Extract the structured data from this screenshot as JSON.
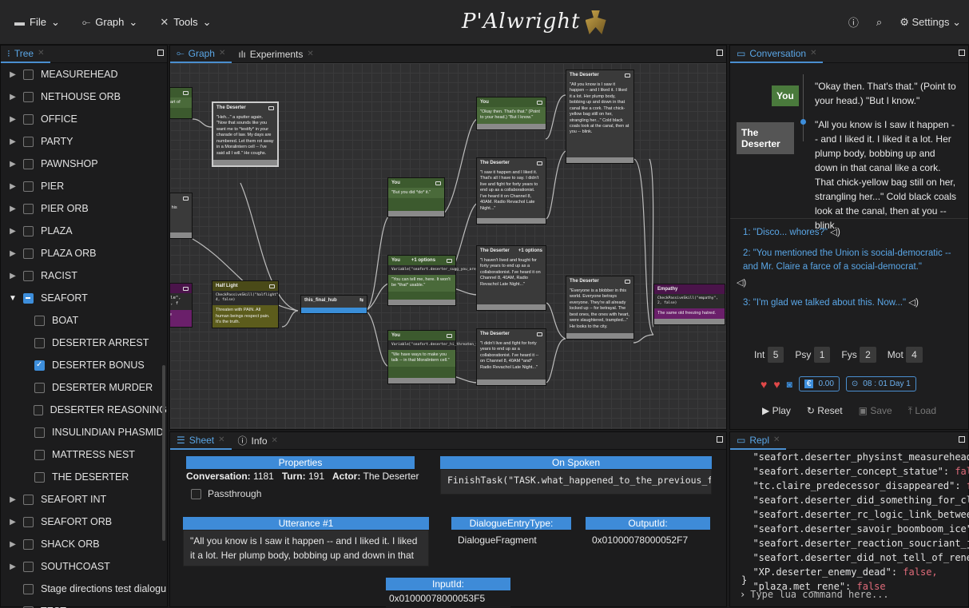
{
  "menu": {
    "file": "File",
    "graph": "Graph",
    "tools": "Tools",
    "settings": "Settings"
  },
  "logo": "P'Alwright",
  "tree": {
    "tab": "Tree",
    "items": [
      {
        "label": "MEASUREHEAD",
        "state": "none",
        "expand": "collapsed",
        "indent": 0
      },
      {
        "label": "NETHOUSE ORB",
        "state": "none",
        "expand": "collapsed",
        "indent": 0
      },
      {
        "label": "OFFICE",
        "state": "none",
        "expand": "collapsed",
        "indent": 0
      },
      {
        "label": "PARTY",
        "state": "none",
        "expand": "collapsed",
        "indent": 0
      },
      {
        "label": "PAWNSHOP",
        "state": "none",
        "expand": "collapsed",
        "indent": 0
      },
      {
        "label": "PIER",
        "state": "none",
        "expand": "collapsed",
        "indent": 0
      },
      {
        "label": "PIER ORB",
        "state": "none",
        "expand": "collapsed",
        "indent": 0
      },
      {
        "label": "PLAZA",
        "state": "none",
        "expand": "collapsed",
        "indent": 0
      },
      {
        "label": "PLAZA ORB",
        "state": "none",
        "expand": "collapsed",
        "indent": 0
      },
      {
        "label": "RACIST",
        "state": "none",
        "expand": "collapsed",
        "indent": 0
      },
      {
        "label": "SEAFORT",
        "state": "partial",
        "expand": "expanded",
        "indent": 0
      },
      {
        "label": "BOAT",
        "state": "none",
        "expand": "leaf",
        "indent": 1
      },
      {
        "label": "DESERTER ARREST",
        "state": "none",
        "expand": "leaf",
        "indent": 1
      },
      {
        "label": "DESERTER BONUS",
        "state": "checked",
        "expand": "leaf",
        "indent": 1
      },
      {
        "label": "DESERTER MURDER",
        "state": "none",
        "expand": "leaf",
        "indent": 1
      },
      {
        "label": "DESERTER REASONING",
        "state": "none",
        "expand": "leaf",
        "indent": 1
      },
      {
        "label": "INSULINDIAN PHASMID",
        "state": "none",
        "expand": "leaf",
        "indent": 1
      },
      {
        "label": "MATTRESS NEST",
        "state": "none",
        "expand": "leaf",
        "indent": 1
      },
      {
        "label": "THE DESERTER",
        "state": "none",
        "expand": "leaf",
        "indent": 1
      },
      {
        "label": "SEAFORT INT",
        "state": "none",
        "expand": "collapsed",
        "indent": 0
      },
      {
        "label": "SEAFORT ORB",
        "state": "none",
        "expand": "collapsed",
        "indent": 0
      },
      {
        "label": "SHACK ORB",
        "state": "none",
        "expand": "collapsed",
        "indent": 0
      },
      {
        "label": "SOUTHCOAST",
        "state": "none",
        "expand": "collapsed",
        "indent": 0
      },
      {
        "label": "Stage directions test dialogu",
        "state": "none",
        "expand": "leaf",
        "indent": 0
      },
      {
        "label": "TEST",
        "state": "none",
        "expand": "collapsed",
        "indent": 0
      }
    ]
  },
  "graph": {
    "tabs": [
      "Graph",
      "Experiments"
    ],
    "nodes": {
      "d1": {
        "title": "The Deserter",
        "body": "\"Heh...\" a sputter again. \"Now that sounds like you want me to *testify* in your charade of law. My days are numbered. Let them rot away in a Moralintern cell -- I've said all I will.\" He coughs."
      },
      "half": {
        "title": "Half Light",
        "code": "CheckPassiveSkill(\"halflight\", 4, false)",
        "body": "Threaten with PAIN. All human beings respect pain. It's the truth."
      },
      "hub": {
        "title": "this_final_hub"
      },
      "you1": {
        "title": "You",
        "body": "\"But you did *do* it.\""
      },
      "you2": {
        "title": "You",
        "opts": "+1 options",
        "code": "Variable[\"seafort.deserter_sugg_you_are_babbies\"]",
        "body": "\"You can tell me, here. It won't be *that* usable.\""
      },
      "you3": {
        "title": "You",
        "code": "Variable[\"seafort.deserter_hi_threaten_with_pain\"]",
        "body": "\"We have ways to make you talk -- in that Moralintern cell.\""
      },
      "you4": {
        "title": "You",
        "body": "\"Okay then. That's that.\" (Point to your head.) \"But I know.\""
      },
      "d2": {
        "title": "The Deserter",
        "body": "\"All you know is I saw it happen -- and I liked it. I liked it a lot. Her plump body, bobbing up and down in that canal like a cork. That chick-yellow bag still on her, strangling her...\" Cold black coals look at the canal, then at you -- blink."
      },
      "d3": {
        "title": "The Deserter",
        "body": "\"I saw it happen and I liked it. That's all I have to say. I didn't live and fight for forty years to end up as a collaborationist. I've heard it on Channel 8, 40AM. Radio Revachol Late Night...\""
      },
      "d4": {
        "title": "The Deserter",
        "opts": "+1 options",
        "body": "\"I haven't lived and fought for forty years to end up as a collaborationist. I've heard it on Channel 8, 40AM, Radio Revachol Late Night...\""
      },
      "d5": {
        "title": "The Deserter",
        "body": "\"I didn't live and fight for forty years to end up as a collaborationist. I've heard it -- on Channel 8, 40AM *and* Radio Revachol Late Night...\""
      },
      "d6": {
        "title": "The Deserter",
        "body": "\"Everyone is a blobber in this world. Everyone betrays everyone. They're all already locked up -- for betrayal. The best ones, the ones with heart, were slaughtered, trampled...\" He looks to the city."
      },
      "emp": {
        "title": "Empathy",
        "code": "CheckPassiveSkill(\"empathy\", 2, false)",
        "body": "The same old freezing hatred."
      },
      "frag1": {
        "title": "eart of"
      },
      "frag2": {
        "title": "p his"
      },
      "frag3": {
        "code": "ple\", 4, f",
        "body": "re"
      }
    }
  },
  "conversation": {
    "tab": "Conversation",
    "you_label": "You",
    "you_text": "\"Okay then. That's that.\" (Point to your head.) \"But I know.\"",
    "npc_label": "The Deserter",
    "npc_text": "\"All you know is I saw it happen -- and I liked it. I liked it a lot. Her plump body, bobbing up and down in that canal like a cork. That chick-yellow bag still on her, strangling her...\" Cold black coals look at the canal, then at you -- blink.",
    "choices": [
      "1: \"Disco... whores?\"",
      "2: \"You mentioned the Union is social-democratic -- and Mr. Claire a farce of a social-democrat.\"",
      "3: \"I'm glad we talked about this. Now...\""
    ],
    "stats": [
      {
        "k": "Int",
        "v": "5"
      },
      {
        "k": "Psy",
        "v": "1"
      },
      {
        "k": "Fys",
        "v": "2"
      },
      {
        "k": "Mot",
        "v": "4"
      }
    ],
    "money": "0.00",
    "time": "08 : 01 Day 1",
    "actions": [
      "Play",
      "Reset",
      "Save",
      "Load"
    ]
  },
  "sheet": {
    "tabs": [
      "Sheet",
      "Info"
    ],
    "properties_hdr": "Properties",
    "conv_label": "Conversation:",
    "conv_val": "1181",
    "turn_label": "Turn:",
    "turn_val": "191",
    "actor_label": "Actor:",
    "actor_val": "The Deserter",
    "passthrough": "Passthrough",
    "onspoken_hdr": "On Spoken",
    "onspoken_val": "FinishTask(\"TASK.what_happened_to_the_previous_fo",
    "utter_hdr": "Utterance #1",
    "utter_val": "\"All you know is I saw it happen -- and I liked it. I liked it a lot. Her plump body, bobbing up and down in that canal like a cork. That chick-yellow bag still on her",
    "det_hdr": "DialogueEntryType:",
    "det_val": "DialogueFragment",
    "out_hdr": "OutputId:",
    "out_val": "0x01000078000052F7",
    "in_hdr": "InputId:",
    "in_val": "0x01000078000053F5"
  },
  "repl": {
    "tab": "Repl",
    "lines": [
      {
        "k": "\"seafort.deserter_physinst_measurehead\"",
        "v": "false"
      },
      {
        "k": "\"seafort.deserter_concept_statue\"",
        "v": "false"
      },
      {
        "k": "\"tc.claire_predecessor_disappeared\"",
        "v": "false"
      },
      {
        "k": "\"seafort.deserter_did_something_for_claire\"",
        "v": "false"
      },
      {
        "k": "\"seafort.deserter_rc_logic_link_between_\"",
        "v": ""
      },
      {
        "k": "\"seafort.deserter_savoir_boomboom_ice\"",
        "v": ""
      },
      {
        "k": "\"seafort.deserter_reaction_soucriant_joy\"",
        "v": ""
      },
      {
        "k": "\"seafort.deserter_did_not_tell_of_rene\"",
        "v": ""
      },
      {
        "k": "\"XP.deserter_enemy_dead\"",
        "v": "false,"
      },
      {
        "k": "\"plaza.met_rene\"",
        "v": "false"
      }
    ],
    "close": "}",
    "placeholder": "Type lua command here..."
  }
}
